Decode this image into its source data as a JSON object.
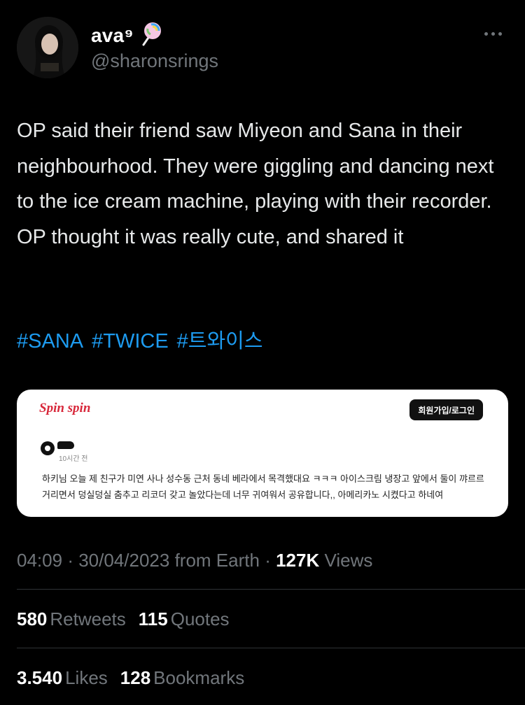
{
  "author": {
    "display_name": "ava⁹",
    "emoji": "lollipop-icon",
    "handle": "@sharonsrings"
  },
  "tweet": {
    "text": "OP said their friend saw Miyeon and Sana in their neighbourhood. They were giggling and dancing next to the ice cream machine, playing with their recorder. OP thought it was really cute, and shared it",
    "hashtags": [
      "#SANA",
      "#TWICE",
      "#트와이스"
    ]
  },
  "card": {
    "logo": "Spin spin",
    "login_label": "회원가입/로그인",
    "time_ago": "10시간 전",
    "post_text": "하키님 오늘 제 친구가 미연 사나 성수동 근처 동네 베라에서 목격했대요 ㅋㅋㅋ 아이스크림 냉장고 앞에서 둘이 꺄르르 거리면서 덩실덩실 춤추고 리코더 갖고 놀았다는데 너무 귀여워서 공유합니다,, 아메리카노 시켰다고 하네여"
  },
  "meta": {
    "time": "04:09",
    "date": "30/04/2023",
    "source": "from Earth",
    "views_count": "127K",
    "views_label": "Views"
  },
  "stats": {
    "retweets_count": "580",
    "retweets_label": "Retweets",
    "quotes_count": "115",
    "quotes_label": "Quotes",
    "likes_count": "3.540",
    "likes_label": "Likes",
    "bookmarks_count": "128",
    "bookmarks_label": "Bookmarks"
  },
  "colors": {
    "background": "#000000",
    "link": "#1d9bf0",
    "muted": "#71767b",
    "card_logo": "#d8283b"
  }
}
